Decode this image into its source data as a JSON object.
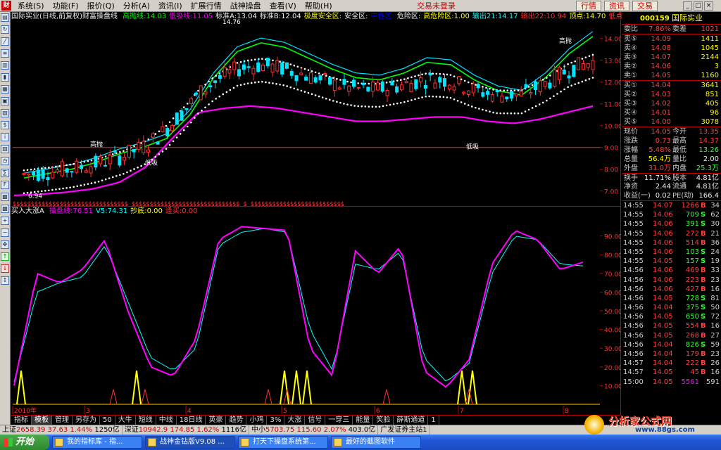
{
  "menubar": {
    "items": [
      "系统(S)",
      "功能(F)",
      "报价(Q)",
      "分析(A)",
      "资讯(I)",
      "扩展行情",
      "战神操盘",
      "查看(V)",
      "帮助(H)"
    ],
    "login_status": "交易未登录",
    "buttons": [
      "行情",
      "资讯",
      "交易"
    ]
  },
  "lefttoolbar": {
    "icons": [
      "chart-icon",
      "refresh-icon",
      "line-icon",
      "list-icon",
      "report-icon",
      "bar-icon",
      "grid-icon",
      "book-icon",
      "news-icon",
      "money-icon",
      "info-icon",
      "chart2-icon",
      "minute-icon",
      "calc-icon",
      "f10-icon",
      "table-icon",
      "table2-icon",
      "zoom-in-icon",
      "zoom-out-icon",
      "pan-icon",
      "up-arrow-icon",
      "down-arrow-icon",
      "scale-icon"
    ]
  },
  "chart": {
    "title": "国际实业(日线,前复权)财富操盘线",
    "indicators": [
      {
        "text": "高抛线:14.03",
        "color": "#0f0"
      },
      {
        "text": "低吸线:11.05",
        "color": "#f0f"
      },
      {
        "text": "标准A:13.04",
        "color": "#eee"
      },
      {
        "text": "标准B:12.04",
        "color": "#eee"
      },
      {
        "text": "极度安全区:",
        "color": "#ff0"
      },
      {
        "text": "安全区:",
        "color": "#eee"
      },
      {
        "text": "中性区:",
        "color": "#00f"
      },
      {
        "text": "危险区:",
        "color": "#eee"
      },
      {
        "text": "高危险区:1.00",
        "color": "#ff0"
      },
      {
        "text": "输出21:14.17",
        "color": "#0ff"
      },
      {
        "text": "输出22:10.94",
        "color": "#f33"
      },
      {
        "text": "顶点:14.70",
        "color": "#ff0"
      },
      {
        "text": "低点:0.00",
        "color": "#f33"
      }
    ],
    "price_axis": [
      "14.00",
      "13.00",
      "12.00",
      "11.00",
      "10.00",
      "9.00",
      "8.00",
      "7.00"
    ],
    "annotations": {
      "high_peak": "14.76",
      "high_label": "高抛",
      "low_label": "低吸",
      "low_start": "6.94",
      "high_label2": "高抛"
    },
    "dollar_signs": "$$$$$$$$$$$$$$$$$$$$$$$$$$$$$$$$  $$$$$$$$$$$$$$$$$$$$$$$$$$$$$$   $  $$$$$$$$$$$$$$$$$$$$$$$$$$",
    "sub_title": "买入大涨A",
    "sub_indicators": [
      {
        "text": "操盘线:76.51",
        "color": "#f0f"
      },
      {
        "text": "V5:74.31",
        "color": "#0ff"
      },
      {
        "text": "抄底:0.00",
        "color": "#ff0"
      },
      {
        "text": "逢买:0.00",
        "color": "#f33"
      }
    ],
    "sub_axis": [
      "90.00",
      "80.00",
      "70.00",
      "60.00",
      "50.00",
      "40.00",
      "30.00",
      "20.00",
      "10.00"
    ],
    "date_axis": [
      "2010年",
      "3",
      "4",
      "5",
      "6",
      "7",
      "8"
    ]
  },
  "chart_data": [
    {
      "type": "line",
      "title": "国际实业(日线,前复权)财富操盘线",
      "ylim": [
        6.7,
        14.7
      ],
      "series": [
        {
          "name": "高抛线",
          "color": "#00ff00",
          "values": [
            7.6,
            7.8,
            8.0,
            8.3,
            8.7,
            9.0,
            9.4,
            10.5,
            12.2,
            13.4,
            13.8,
            13.6,
            13.1,
            12.6,
            12.2,
            12.1,
            12.4,
            12.9,
            12.8,
            12.1,
            11.6,
            11.4,
            12.2,
            13.3,
            14.1
          ]
        },
        {
          "name": "低吸线",
          "color": "#ff00ff",
          "values": [
            6.8,
            6.85,
            6.95,
            7.1,
            7.4,
            8.1,
            9.4,
            10.6,
            10.8,
            10.9,
            10.8,
            10.6,
            10.4,
            10.2,
            10.2,
            10.3,
            10.4,
            10.4,
            10.2,
            10.1,
            10.3,
            10.6,
            10.9
          ]
        }
      ],
      "peak": 14.76,
      "trough": 6.94
    },
    {
      "type": "line",
      "title": "买入大涨A",
      "ylim": [
        0,
        100
      ],
      "series": [
        {
          "name": "操盘线",
          "color": "#ff00ff",
          "values": [
            10,
            70,
            65,
            72,
            88,
            50,
            20,
            15,
            35,
            88,
            95,
            94,
            93,
            30,
            15,
            82,
            70,
            85,
            18,
            9,
            24,
            75,
            93,
            88,
            72,
            76
          ]
        },
        {
          "name": "V5",
          "color": "#00ffff",
          "values": [
            12,
            60,
            65,
            68,
            85,
            55,
            25,
            18,
            30,
            85,
            92,
            94,
            92,
            40,
            18,
            75,
            72,
            82,
            25,
            12,
            22,
            70,
            90,
            88,
            75,
            74
          ]
        }
      ]
    }
  ],
  "tabs": [
    "指标",
    "模板",
    "管理",
    "另存为",
    "50",
    "大牛",
    "短线",
    "中线",
    "18日线",
    "英豪",
    "趋势",
    "小鸡",
    "3%",
    "大涨",
    "信号",
    "一穿三",
    "能量",
    "笑脸",
    "薛斯通道",
    "1"
  ],
  "status": {
    "sh_label": "上证",
    "sh_val": "2658.39",
    "sh_chg": "37.63",
    "sh_pct": "1.44%",
    "sh_amt": "1250亿",
    "sz_label": "深证",
    "sz_val": "10942.9",
    "sz_chg": "174.85",
    "sz_pct": "1.62%",
    "sz_amt": "1116亿",
    "zx_label": "中小",
    "zx_val": "5703.75",
    "zx_chg": "115.60",
    "zx_pct": "2.07%",
    "zx_amt": "403.0亿",
    "broker": "广发证券主站1"
  },
  "watermark": {
    "title": "分析家公式网",
    "url": "www.88gs.com"
  },
  "taskbar": {
    "start": "开始",
    "tasks": [
      "我的指标库 - 指...",
      "战神金钻版V9.08 ...",
      "打天下操盘系统第...",
      "最好的截图软件"
    ]
  },
  "rightpanel": {
    "code": "000159",
    "name": "国际实业",
    "weibi_label": "委比",
    "weibi": "7.86%",
    "weicha_label": "委差",
    "weicha": "1021",
    "sell": [
      {
        "label": "卖⑤",
        "price": "14.09",
        "vol": "1411"
      },
      {
        "label": "卖④",
        "price": "14.08",
        "vol": "1045"
      },
      {
        "label": "卖③",
        "price": "14.07",
        "vol": "2144"
      },
      {
        "label": "卖②",
        "price": "14.06",
        "vol": "3"
      },
      {
        "label": "卖①",
        "price": "14.05",
        "vol": "1160"
      }
    ],
    "buy": [
      {
        "label": "买①",
        "price": "14.04",
        "vol": "3641"
      },
      {
        "label": "买②",
        "price": "14.03",
        "vol": "851"
      },
      {
        "label": "买③",
        "price": "14.02",
        "vol": "405"
      },
      {
        "label": "买④",
        "price": "14.01",
        "vol": "96"
      },
      {
        "label": "买⑤",
        "price": "14.00",
        "vol": "3078"
      }
    ],
    "quote": [
      {
        "l1": "现价",
        "v1": "14.05",
        "c1": "red",
        "l2": "今开",
        "v2": "13.35",
        "c2": "red"
      },
      {
        "l1": "涨跌",
        "v1": "0.73",
        "c1": "red",
        "l2": "最高",
        "v2": "14.37",
        "c2": "red"
      },
      {
        "l1": "涨幅",
        "v1": "5.48%",
        "c1": "red",
        "l2": "最低",
        "v2": "13.26",
        "c2": "grn"
      },
      {
        "l1": "总量",
        "v1": "56.4万",
        "c1": "yel",
        "l2": "量比",
        "v2": "2.00",
        "c2": "wht"
      },
      {
        "l1": "外盘",
        "v1": "31.0万",
        "c1": "red",
        "l2": "内盘",
        "v2": "25.3万",
        "c2": "grn"
      },
      {
        "l1": "换手",
        "v1": "11.71%",
        "c1": "wht",
        "l2": "股本",
        "v2": "4.81亿",
        "c2": "wht"
      },
      {
        "l1": "净资",
        "v1": "2.44",
        "c1": "wht",
        "l2": "流通",
        "v2": "4.81亿",
        "c2": "wht"
      },
      {
        "l1": "收益(一)",
        "v1": "0.02",
        "c1": "wht",
        "l2": "PE(动)",
        "v2": "166.4",
        "c2": "wht"
      }
    ],
    "trades": [
      {
        "t": "14:55",
        "p": "14.07",
        "v": "1266",
        "bs": "B",
        "n": "34"
      },
      {
        "t": "14:55",
        "p": "14.06",
        "v": "709",
        "bs": "S",
        "n": "62"
      },
      {
        "t": "14:55",
        "p": "14.06",
        "v": "391",
        "bs": "S",
        "n": "30"
      },
      {
        "t": "14:55",
        "p": "14.06",
        "v": "272",
        "bs": "B",
        "n": "21"
      },
      {
        "t": "14:55",
        "p": "14.06",
        "v": "514",
        "bs": "B",
        "n": "36"
      },
      {
        "t": "14:55",
        "p": "14.06",
        "v": "103",
        "bs": "S",
        "n": "24"
      },
      {
        "t": "14:55",
        "p": "14.05",
        "v": "157",
        "bs": "S",
        "n": "19"
      },
      {
        "t": "14:56",
        "p": "14.06",
        "v": "469",
        "bs": "B",
        "n": "33"
      },
      {
        "t": "14:56",
        "p": "14.06",
        "v": "223",
        "bs": "B",
        "n": "23"
      },
      {
        "t": "14:56",
        "p": "14.06",
        "v": "427",
        "bs": "B",
        "n": "16"
      },
      {
        "t": "14:56",
        "p": "14.05",
        "v": "728",
        "bs": "S",
        "n": "81"
      },
      {
        "t": "14:56",
        "p": "14.04",
        "v": "375",
        "bs": "S",
        "n": "50"
      },
      {
        "t": "14:56",
        "p": "14.05",
        "v": "650",
        "bs": "S",
        "n": "72"
      },
      {
        "t": "14:56",
        "p": "14.05",
        "v": "554",
        "bs": "B",
        "n": "16"
      },
      {
        "t": "14:56",
        "p": "14.05",
        "v": "268",
        "bs": "B",
        "n": "27"
      },
      {
        "t": "14:56",
        "p": "14.04",
        "v": "826",
        "bs": "S",
        "n": "59"
      },
      {
        "t": "14:56",
        "p": "14.04",
        "v": "179",
        "bs": "B",
        "n": "23"
      },
      {
        "t": "14:57",
        "p": "14.04",
        "v": "222",
        "bs": "B",
        "n": "26"
      },
      {
        "t": "14:57",
        "p": "14.05",
        "v": "45",
        "bs": "B",
        "n": "16"
      },
      {
        "t": "15:00",
        "p": "14.05",
        "v": "5561",
        "bs": "",
        "n": "591"
      }
    ]
  }
}
